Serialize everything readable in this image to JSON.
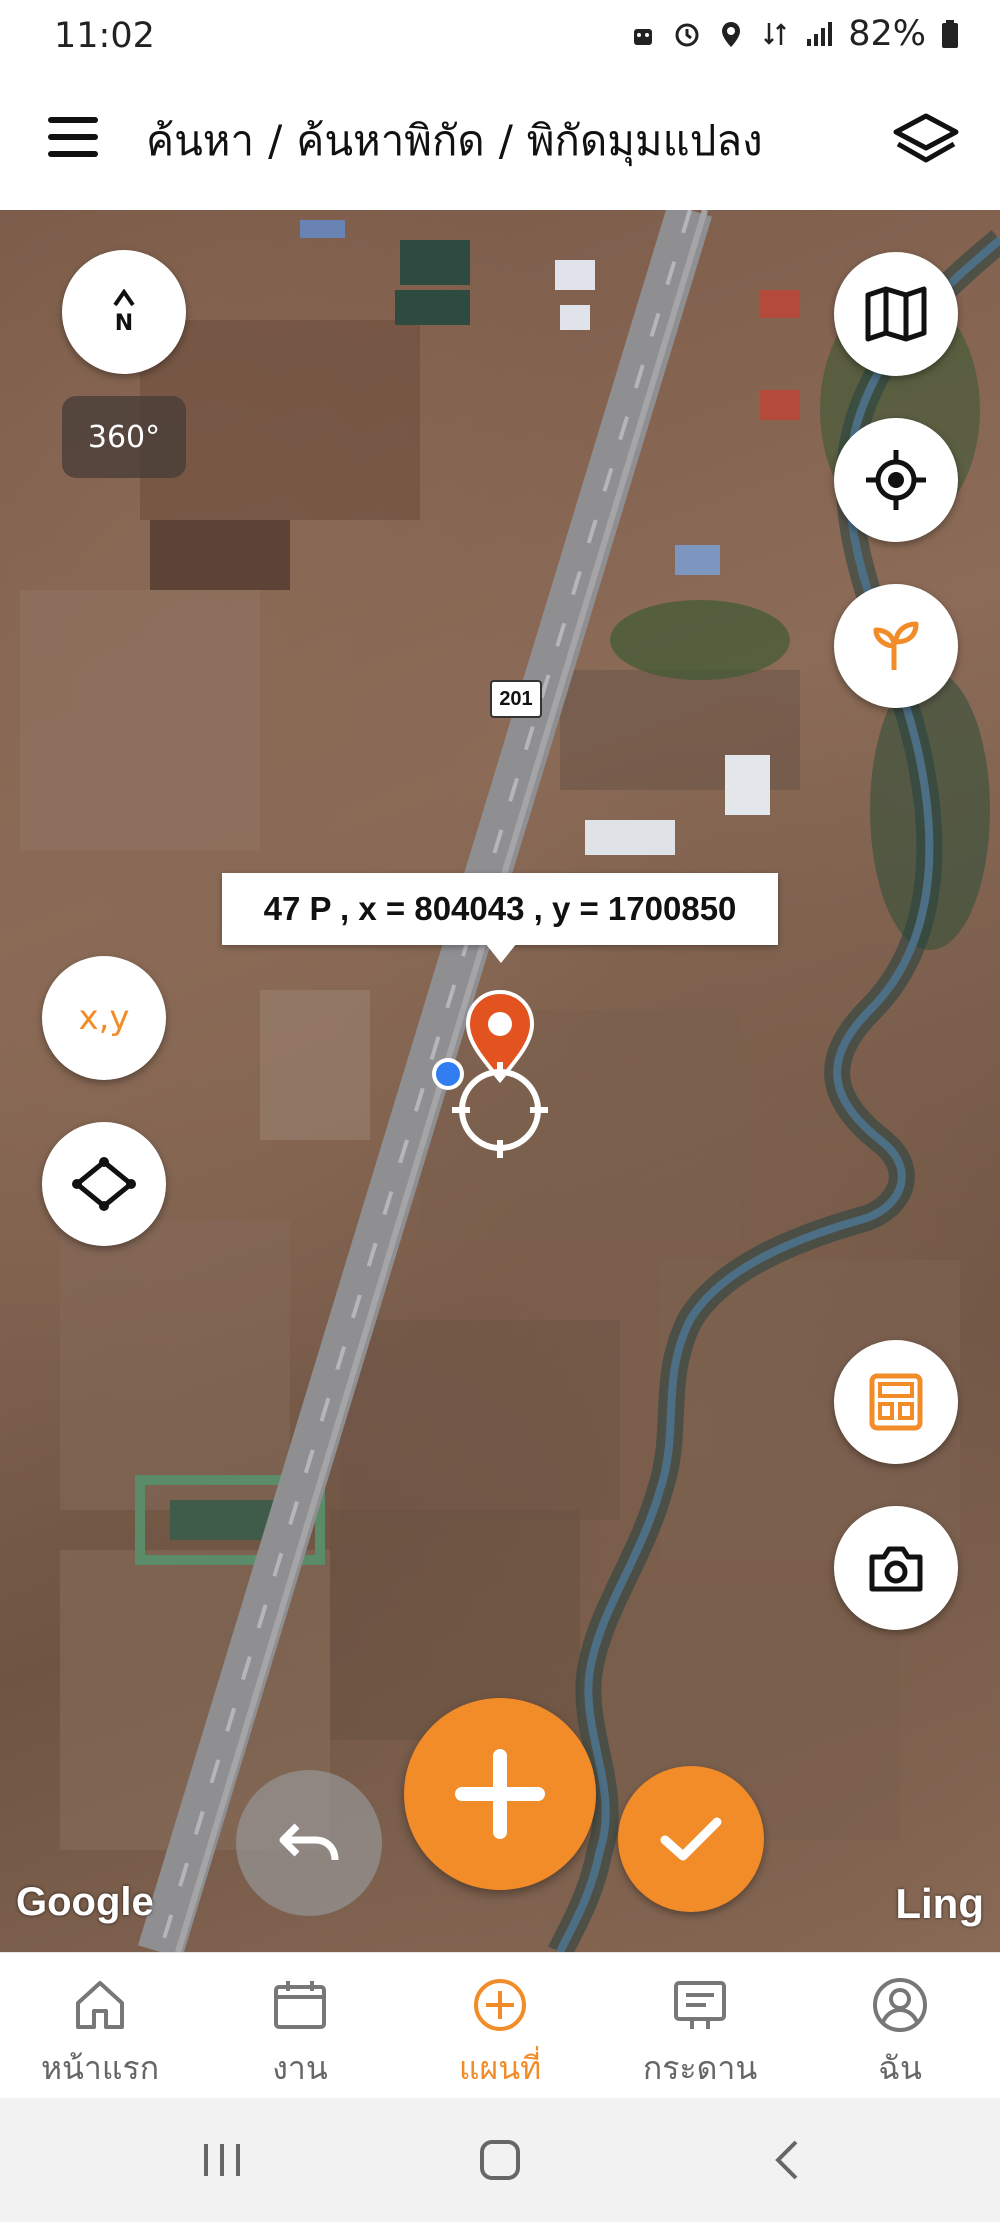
{
  "status_bar": {
    "time": "11:02",
    "battery": "82%"
  },
  "header": {
    "breadcrumb": [
      "ค้นหา",
      "ค้นหาพิกัด",
      "พิกัดมุมแปลง"
    ],
    "separator": "/"
  },
  "map": {
    "compass_letter": "N",
    "compass_degrees": "360°",
    "coordinate_label": "47 P , x = 804043 , y = 1700850",
    "road_number": "201",
    "xy_button_label": "x,y",
    "google_watermark": "Google",
    "ling_watermark": "Ling",
    "accent_color": "#f28c28",
    "pin_color": "#e2531f"
  },
  "bottom_nav": {
    "items": [
      {
        "label": "หน้าแรก",
        "icon": "home-icon"
      },
      {
        "label": "งาน",
        "icon": "calendar-icon"
      },
      {
        "label": "แผนที่",
        "icon": "plus-circle-icon",
        "active": true
      },
      {
        "label": "กระดาน",
        "icon": "board-icon"
      },
      {
        "label": "ฉัน",
        "icon": "profile-icon"
      }
    ]
  }
}
